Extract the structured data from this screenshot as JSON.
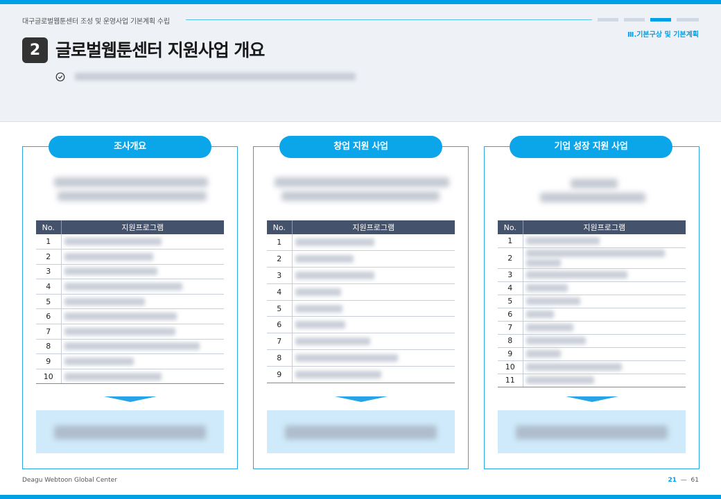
{
  "header": {
    "doc_title": "대구글로벌웹툰센터 조성 및 운영사업 기본계획 수립",
    "section_label": "Ⅲ.기본구상 및 기본계획",
    "section_number": "2",
    "main_title": "글로벌웹툰센터 지원사업 개요"
  },
  "cards": [
    {
      "title": "조사개요",
      "table_headers": [
        "No.",
        "지원프로그램"
      ],
      "rows": [
        "1",
        "2",
        "3",
        "4",
        "5",
        "6",
        "7",
        "8",
        "9",
        "10"
      ]
    },
    {
      "title": "창업 지원 사업",
      "table_headers": [
        "No.",
        "지원프로그램"
      ],
      "rows": [
        "1",
        "2",
        "3",
        "4",
        "5",
        "6",
        "7",
        "8",
        "9"
      ]
    },
    {
      "title": "기업 성장 지원 사업",
      "table_headers": [
        "No.",
        "지원프로그램"
      ],
      "rows": [
        "1",
        "2",
        "3",
        "4",
        "5",
        "6",
        "7",
        "8",
        "9",
        "10",
        "11"
      ]
    }
  ],
  "footer": {
    "org_name": "Deagu Webtoon Global Center",
    "page_current": "21",
    "page_separator": "—",
    "page_total": "61"
  },
  "colors": {
    "accent": "#00a0e9",
    "table_header": "#45526b",
    "result_bg": "#cfeafa"
  }
}
